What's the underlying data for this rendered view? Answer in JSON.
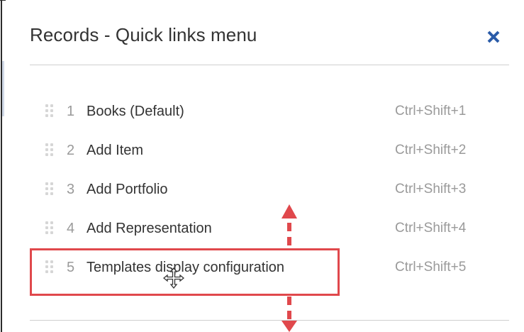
{
  "dialog": {
    "title": "Records - Quick links menu",
    "close_icon": "close-icon"
  },
  "links": [
    {
      "number": "1",
      "label": "Books (Default)",
      "shortcut": "Ctrl+Shift+1"
    },
    {
      "number": "2",
      "label": "Add Item",
      "shortcut": "Ctrl+Shift+2"
    },
    {
      "number": "3",
      "label": "Add Portfolio",
      "shortcut": "Ctrl+Shift+3"
    },
    {
      "number": "4",
      "label": "Add Representation",
      "shortcut": "Ctrl+Shift+4"
    },
    {
      "number": "5",
      "label": "Templates display configuration",
      "shortcut": "Ctrl+Shift+5"
    }
  ],
  "icons": {
    "drag_handle": "drag-handle-icon",
    "move_cursor": "move-cursor-icon",
    "annotation_arrow": "double-arrow-icon"
  },
  "colors": {
    "accent": "#2a5ba8",
    "highlight": "#e0484c",
    "text": "#333333",
    "muted": "#9a9a9a"
  }
}
